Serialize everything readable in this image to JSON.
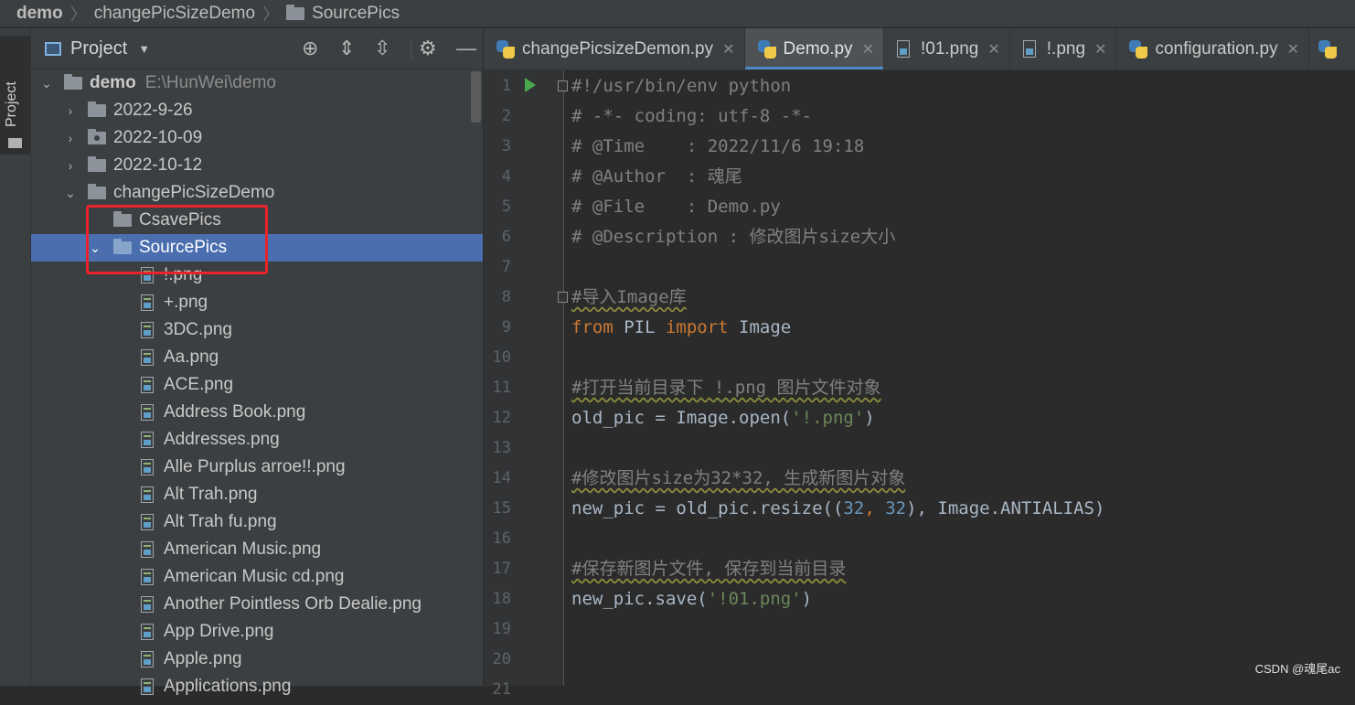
{
  "breadcrumb": {
    "items": [
      "demo",
      "changePicSizeDemo",
      "SourcePics"
    ]
  },
  "toolstrip": {
    "project_tab_label": "Project"
  },
  "project_panel": {
    "title": "Project",
    "root": {
      "name": "demo",
      "path": "E:\\HunWei\\demo"
    },
    "tree": [
      {
        "label": "2022-9-26",
        "kind": "folder"
      },
      {
        "label": "2022-10-09",
        "kind": "folder"
      },
      {
        "label": "2022-10-12",
        "kind": "folder"
      },
      {
        "label": "changePicSizeDemo",
        "kind": "folder"
      },
      {
        "label": "CsavePics",
        "kind": "folder"
      },
      {
        "label": "SourcePics",
        "kind": "folder"
      },
      {
        "label": "!.png",
        "kind": "file"
      },
      {
        "label": "+.png",
        "kind": "file"
      },
      {
        "label": "3DC.png",
        "kind": "file"
      },
      {
        "label": "Aa.png",
        "kind": "file"
      },
      {
        "label": "ACE.png",
        "kind": "file"
      },
      {
        "label": "Address Book.png",
        "kind": "file"
      },
      {
        "label": "Addresses.png",
        "kind": "file"
      },
      {
        "label": "Alle Purplus arroe!!.png",
        "kind": "file"
      },
      {
        "label": "Alt Trah.png",
        "kind": "file"
      },
      {
        "label": "Alt Trah fu.png",
        "kind": "file"
      },
      {
        "label": "American Music.png",
        "kind": "file"
      },
      {
        "label": "American Music cd.png",
        "kind": "file"
      },
      {
        "label": "Another Pointless Orb Dealie.png",
        "kind": "file"
      },
      {
        "label": "App Drive.png",
        "kind": "file"
      },
      {
        "label": "Apple.png",
        "kind": "file"
      },
      {
        "label": "Applications.png",
        "kind": "file"
      }
    ]
  },
  "tabs": [
    {
      "label": "changePicsizeDemon.py",
      "icon": "python-file-icon",
      "active": false
    },
    {
      "label": "Demo.py",
      "icon": "python-file-icon",
      "active": true
    },
    {
      "label": "!01.png",
      "icon": "image-file-icon",
      "active": false
    },
    {
      "label": "!.png",
      "icon": "image-file-icon",
      "active": false
    },
    {
      "label": "configuration.py",
      "icon": "python-file-icon",
      "active": false
    }
  ],
  "editor": {
    "line_numbers": [
      "1",
      "2",
      "3",
      "4",
      "5",
      "6",
      "7",
      "8",
      "9",
      "10",
      "11",
      "12",
      "13",
      "14",
      "15",
      "16",
      "17",
      "18",
      "19",
      "20",
      "21"
    ],
    "lines": {
      "l1": "#!/usr/bin/env python",
      "l2": "# -*- coding: utf-8 -*-",
      "l3": "# @Time    : 2022/11/6 19:18",
      "l4": "# @Author  : 魂尾",
      "l5": "# @File    : Demo.py",
      "l6": "# @Description : 修改图片size大小",
      "l8": "#导入Image库",
      "l9_kw1": "from",
      "l9_mod": " PIL ",
      "l9_kw2": "import",
      "l9_name": " Image",
      "l11": "#打开当前目录下 !.png 图片文件对象",
      "l12_a": "old_pic = Image.open(",
      "l12_s": "'!.png'",
      "l12_b": ")",
      "l14": "#修改图片size为32*32, 生成新图片对象",
      "l15_a": "new_pic = old_pic.resize((",
      "l15_n1": "32",
      "l15_c": ", ",
      "l15_n2": "32",
      "l15_b": "), Image.ANTIALIAS)",
      "l17": "#保存新图片文件, 保存到当前目录",
      "l18_a": "new_pic.save(",
      "l18_s": "'!01.png'",
      "l18_b": ")"
    }
  },
  "watermark": "CSDN @魂尾ac",
  "colors": {
    "selection": "#4b6eaf",
    "highlight_box": "#e8232b",
    "keyword": "#cc7832",
    "string": "#6a8759",
    "number": "#6897bb",
    "comment": "#808080"
  }
}
